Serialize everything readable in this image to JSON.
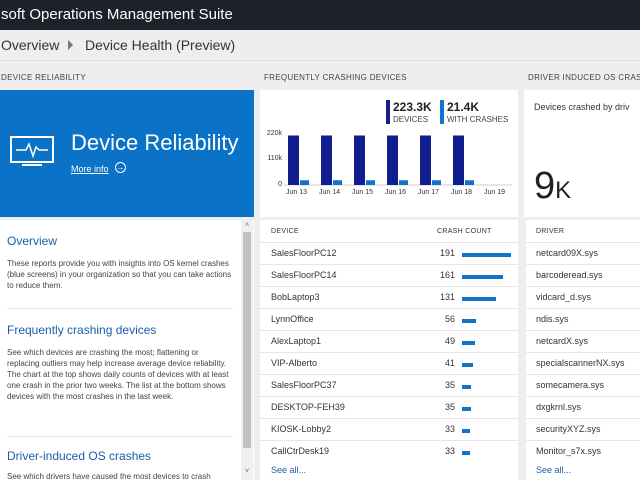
{
  "app": {
    "title": "soft Operations Management Suite"
  },
  "breadcrumb": {
    "root": "Overview",
    "current": "Device Health (Preview)"
  },
  "columns": {
    "reliability": "DEVICE RELIABILITY",
    "crashing": "FREQUENTLY CRASHING DEVICES",
    "driver": "DRIVER INDUCED OS CRASHES"
  },
  "tile": {
    "title": "Device Reliability",
    "more_info": "More info"
  },
  "sections": [
    {
      "title": "Overview",
      "body": "These reports provide you with insights into OS kernel crashes (blue screens) in your organization so that you can take actions to reduce them."
    },
    {
      "title": "Frequently crashing devices",
      "body": "See which devices are crashing the most; flattening or replacing outliers may help increase average device reliability. The chart at the top shows daily counts of devices with at least one crash in the prior two weeks. The list at the bottom shows devices with the most crashes in the last week."
    },
    {
      "title": "Driver-induced OS crashes",
      "body": "See which drivers have caused the most devices to crash"
    }
  ],
  "stats": {
    "devices": {
      "value": "223.3K",
      "label": "DEVICES"
    },
    "with_crashes": {
      "value": "21.4K",
      "label": "WITH CRASHES"
    }
  },
  "chart_data": {
    "type": "bar",
    "categories": [
      "Jun 13",
      "Jun 14",
      "Jun 15",
      "Jun 16",
      "Jun 17",
      "Jun 18",
      "Jun 19"
    ],
    "series": [
      {
        "name": "DEVICES",
        "values": [
          223.3,
          223.3,
          223.3,
          223.3,
          223.3,
          223.3,
          0
        ]
      },
      {
        "name": "WITH CRASHES",
        "values": [
          21.4,
          21.4,
          21.4,
          21.4,
          21.4,
          21.4,
          0
        ]
      }
    ],
    "yticks": [
      "220k",
      "110k",
      "0"
    ],
    "ylim": [
      0,
      230
    ],
    "colors": [
      "#0f1f8f",
      "#1473c8"
    ]
  },
  "driver_tile": {
    "description": "Devices crashed by driv",
    "value": "9",
    "suffix": "K"
  },
  "device_table": {
    "headers": {
      "device": "DEVICE",
      "count": "CRASH COUNT"
    },
    "rows": [
      {
        "device": "SalesFloorPC12",
        "count": 191
      },
      {
        "device": "SalesFloorPC14",
        "count": 161
      },
      {
        "device": "BobLaptop3",
        "count": 131
      },
      {
        "device": "LynnOffice",
        "count": 56
      },
      {
        "device": "AlexLaptop1",
        "count": 49
      },
      {
        "device": "VIP-Alberto",
        "count": 41
      },
      {
        "device": "SalesFloorPC37",
        "count": 35
      },
      {
        "device": "DESKTOP-FEH39",
        "count": 35
      },
      {
        "device": "KIOSK-Lobby2",
        "count": 33
      },
      {
        "device": "CallCtrDesk19",
        "count": 33
      }
    ],
    "see_all": "See all..."
  },
  "driver_table": {
    "header": "DRIVER",
    "rows": [
      "netcard09X.sys",
      "barcoderead.sys",
      "vidcard_d.sys",
      "ndis.sys",
      "netcardX.sys",
      "specialscannerNX.sys",
      "somecamera.sys",
      "dxgkrnl.sys",
      "securityXYZ.sys",
      "Monitor_s7x.sys"
    ],
    "see_all": "See all..."
  }
}
